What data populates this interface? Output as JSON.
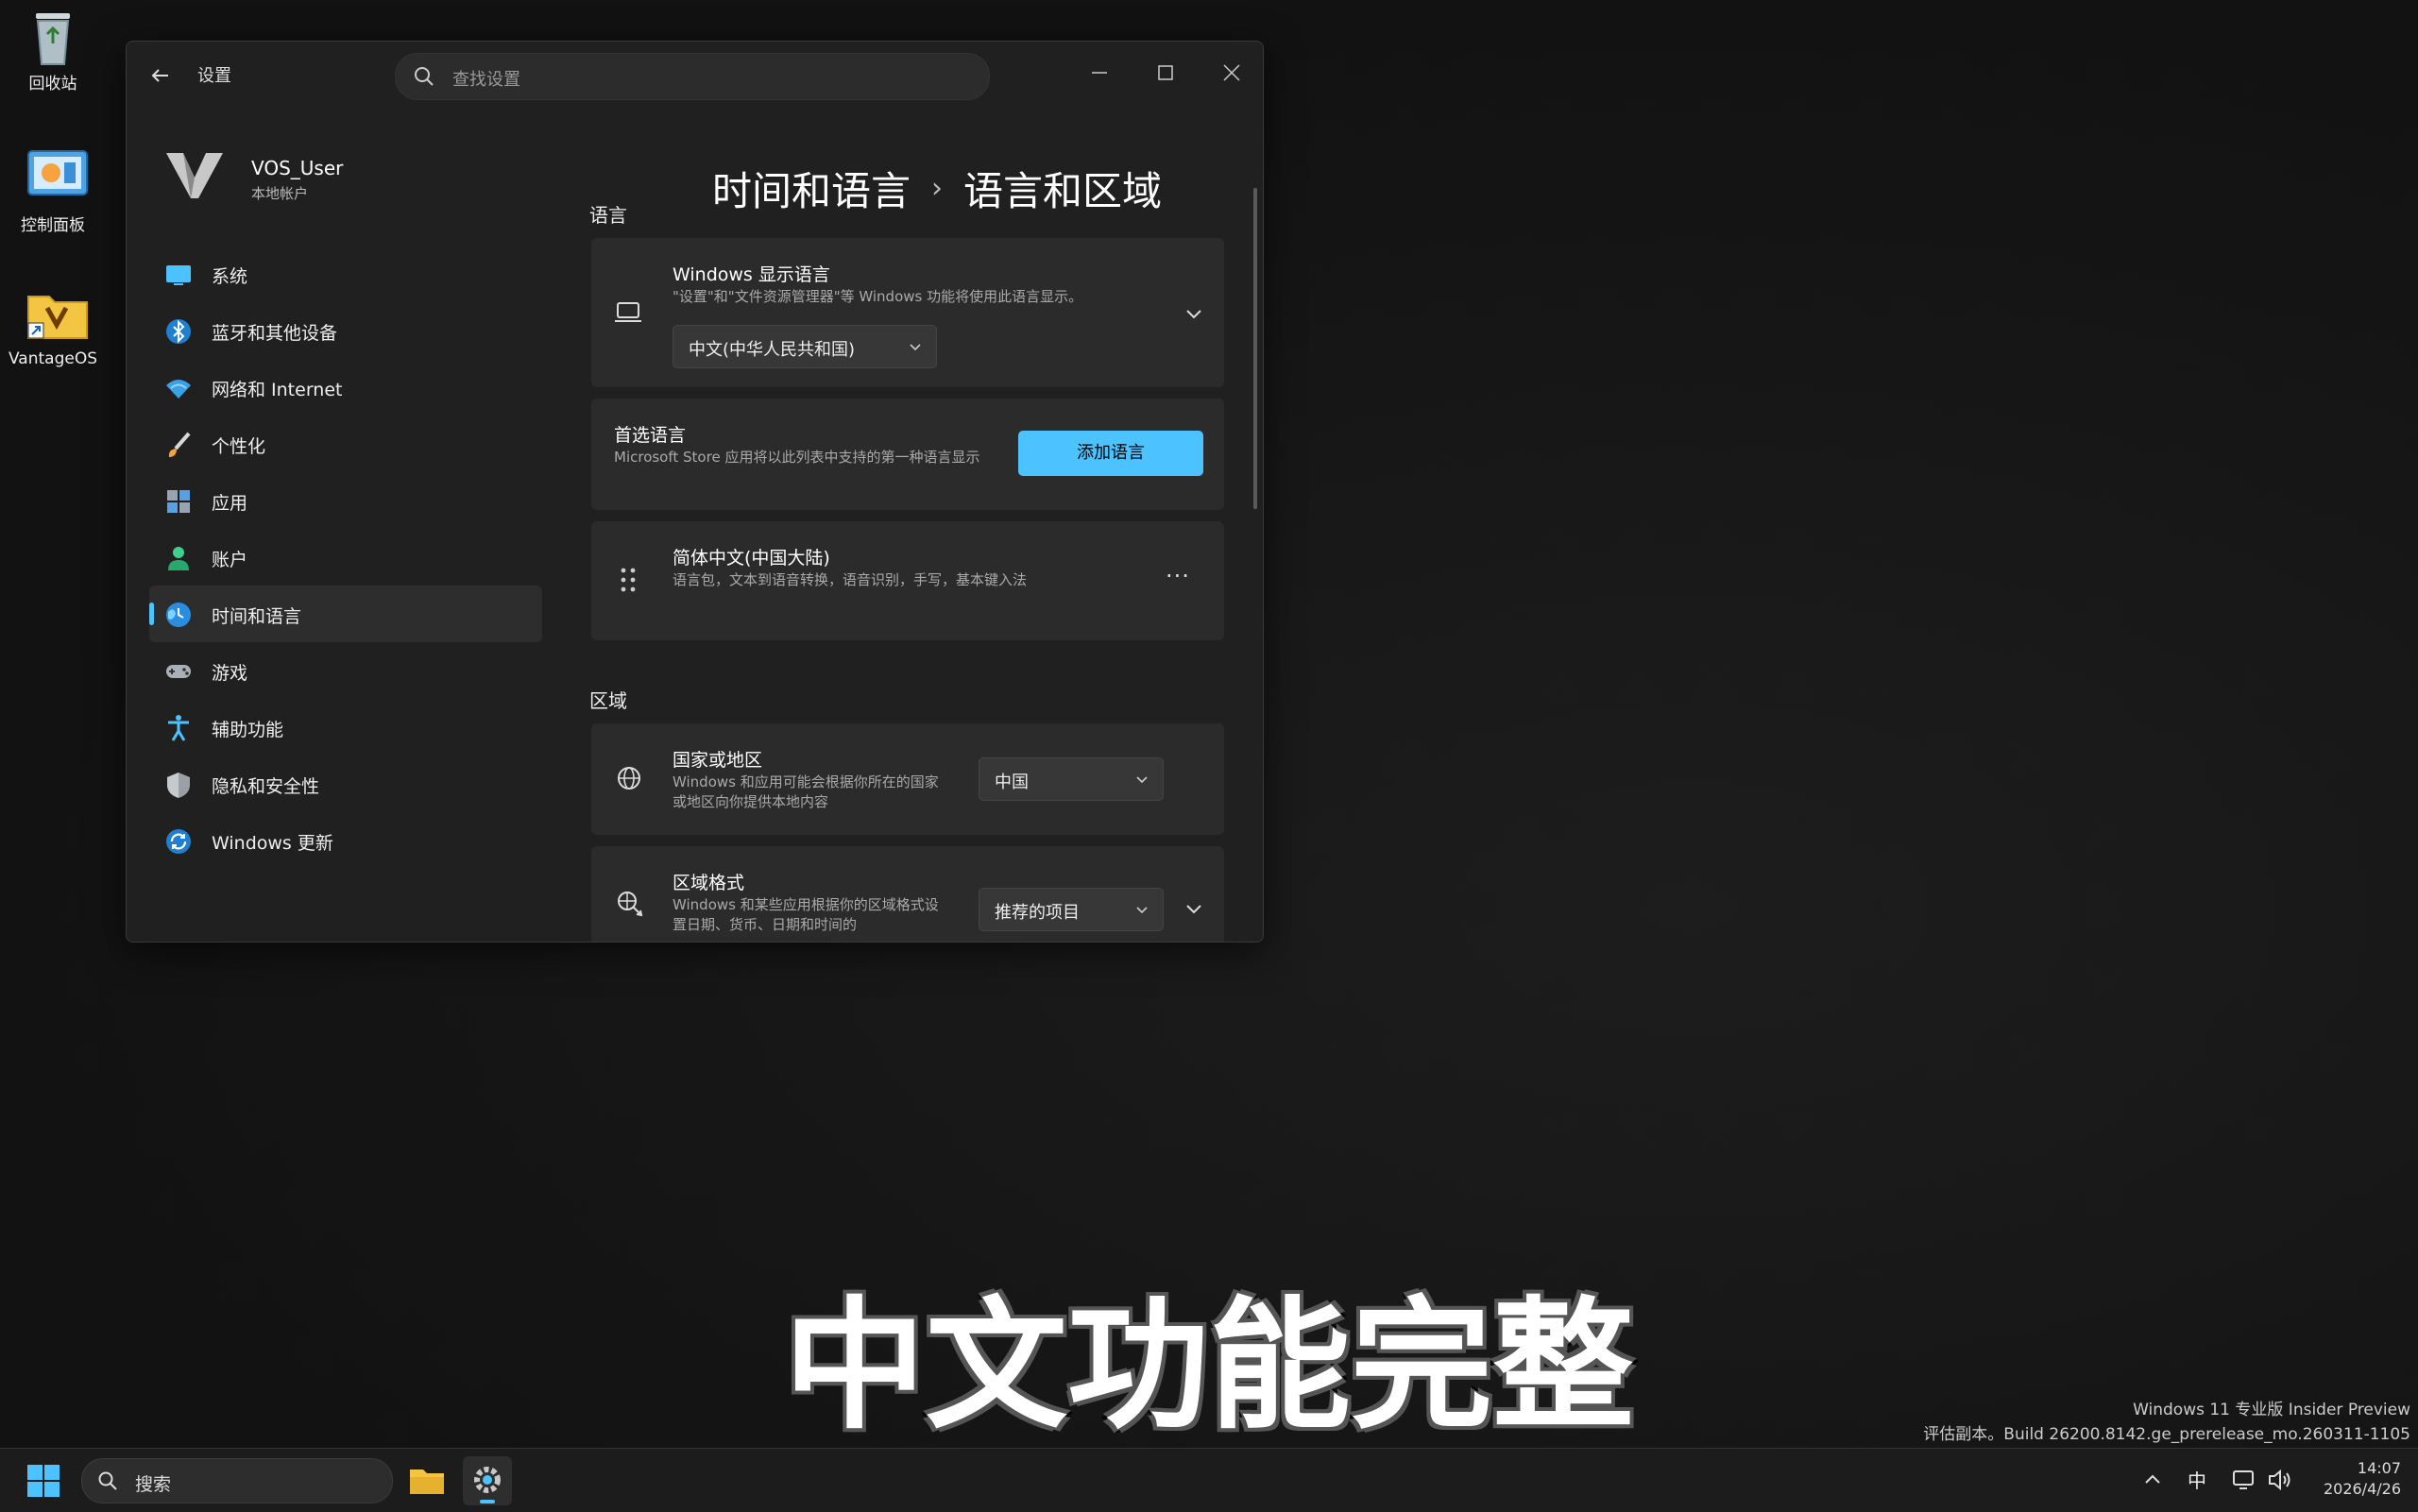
{
  "desktop": {
    "icons": [
      {
        "label": "回收站",
        "icon": "recycle-bin-icon"
      },
      {
        "label": "控制面板",
        "icon": "control-panel-icon"
      },
      {
        "label": "VantageOS",
        "icon": "folder-shortcut-icon"
      }
    ]
  },
  "window": {
    "app_title": "设置",
    "search_placeholder": "查找设置",
    "user": {
      "name": "VOS_User",
      "type": "本地帐户"
    },
    "nav": [
      {
        "label": "系统",
        "icon": "monitor-icon"
      },
      {
        "label": "蓝牙和其他设备",
        "icon": "bluetooth-icon"
      },
      {
        "label": "网络和 Internet",
        "icon": "wifi-icon"
      },
      {
        "label": "个性化",
        "icon": "brush-icon"
      },
      {
        "label": "应用",
        "icon": "apps-icon"
      },
      {
        "label": "账户",
        "icon": "person-icon"
      },
      {
        "label": "时间和语言",
        "icon": "globe-clock-icon",
        "active": true
      },
      {
        "label": "游戏",
        "icon": "gamepad-icon"
      },
      {
        "label": "辅助功能",
        "icon": "accessibility-icon"
      },
      {
        "label": "隐私和安全性",
        "icon": "shield-icon"
      },
      {
        "label": "Windows 更新",
        "icon": "update-icon"
      }
    ],
    "breadcrumb": {
      "parent": "时间和语言",
      "separator": "›",
      "current": "语言和区域"
    },
    "language_section": {
      "title": "语言",
      "display_language": {
        "title": "Windows 显示语言",
        "desc": "\"设置\"和\"文件资源管理器\"等 Windows 功能将使用此语言显示。",
        "value": "中文(中华人民共和国)"
      },
      "preferred": {
        "title": "首选语言",
        "desc": "Microsoft Store 应用将以此列表中支持的第一种语言显示",
        "button": "添加语言"
      },
      "lang_item": {
        "title": "简体中文(中国大陆)",
        "desc": "语言包，文本到语音转换，语音识别，手写，基本键入法",
        "more": "···"
      }
    },
    "region_section": {
      "title": "区域",
      "country": {
        "title": "国家或地区",
        "desc": "Windows 和应用可能会根据你所在的国家或地区向你提供本地内容",
        "value": "中国"
      },
      "format": {
        "title": "区域格式",
        "desc": "Windows 和某些应用根据你的区域格式设置日期、货币、日期和时间的",
        "value": "推荐的项目"
      }
    }
  },
  "caption": "中文功能完整",
  "watermark": {
    "line1": "Windows 11 专业版 Insider Preview",
    "line2": "评估副本。Build 26200.8142.ge_prerelease_mo.260311-1105"
  },
  "taskbar": {
    "search_placeholder": "搜索",
    "tray": {
      "ime": "中"
    },
    "clock": {
      "time": "14:07",
      "date": "2026/4/26"
    }
  },
  "colors": {
    "accent": "#4cc2ff",
    "window_bg": "#202020",
    "card_bg": "#2b2b2b"
  }
}
